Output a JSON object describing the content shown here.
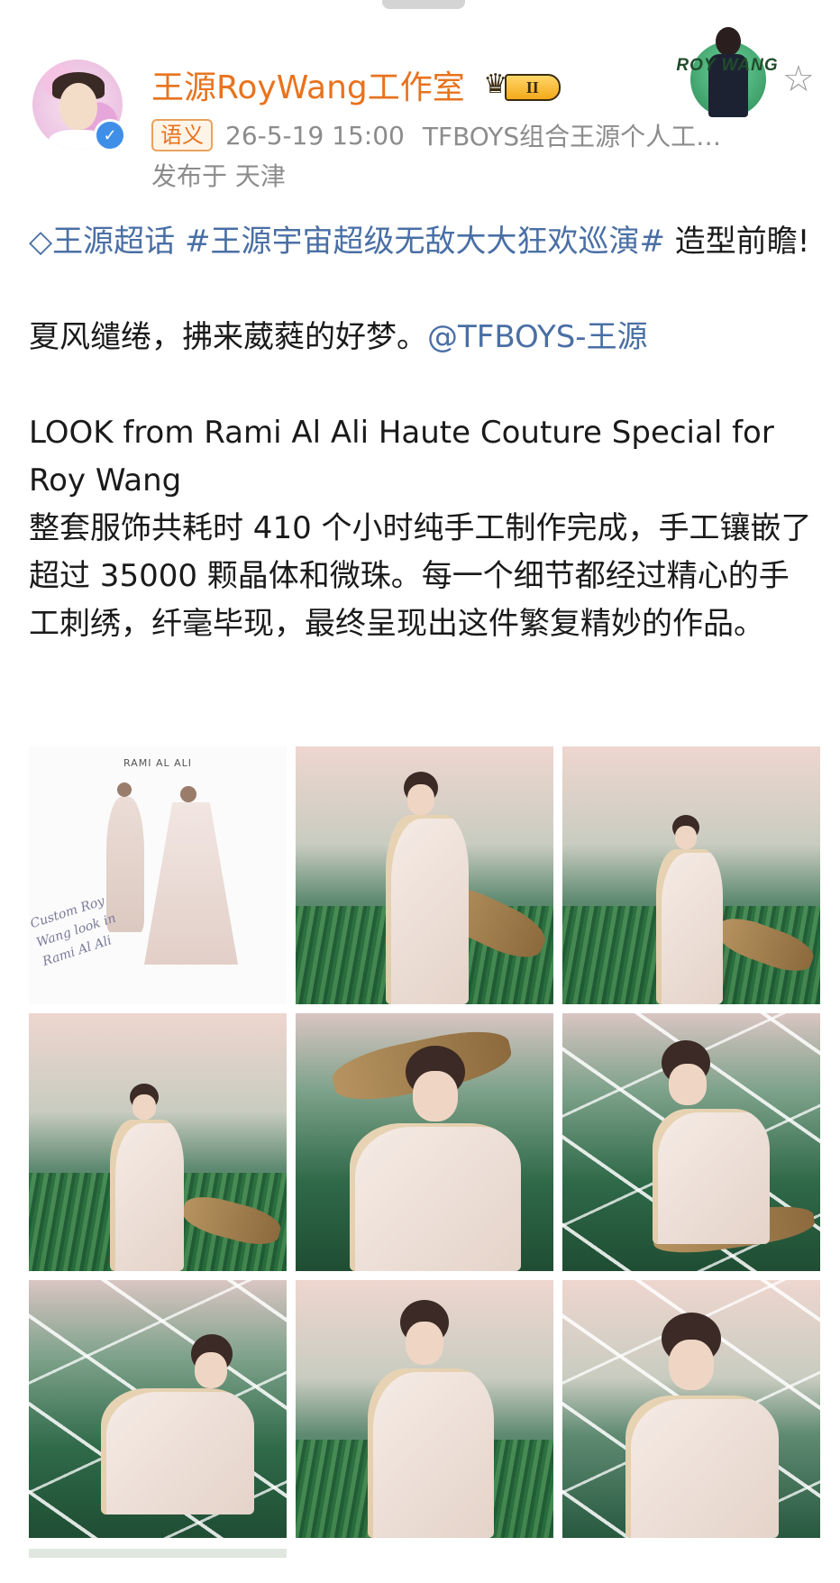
{
  "header": {
    "account_name": "王源RoyWang工作室",
    "vip_level": "II",
    "source_tag": "语义",
    "post_time": "26-5-19 15:00",
    "post_from": "TFBOYS组合王源个人工…",
    "location": "发布于 天津",
    "fan_card_text": "ROY WANG"
  },
  "post": {
    "supertopic": "王源超话",
    "hashtag": "#王源宇宙超级无敌大大狂欢巡演#",
    "line1_suffix": " 造型前瞻!",
    "line2_text": "夏风缱绻，拂来葳蕤的好梦。",
    "mention": "@TFBOYS-王源",
    "line3": "LOOK from Rami Al Ali Haute Couture Special for Roy Wang",
    "line4": "整套服饰共耗时 410 个小时纯手工制作完成，手工镶嵌了超过 35000 颗晶体和微珠。每一个细节都经过精心的手工刺绣，纤毫毕现，最终呈现出这件繁复精妙的作品。"
  },
  "images": {
    "sketch_brand": "RAMI AL ALI",
    "sketch_note": "Custom Roy Wang look in Rami Al Ali"
  },
  "icons": {
    "verified": "verified-check-icon",
    "vip": "crown-icon",
    "follow_star": "star-outline-icon",
    "supertopic": "diamond-icon"
  },
  "colors": {
    "name": "#e8731e",
    "link": "#4a6fa5",
    "meta": "#8c8c8c"
  }
}
